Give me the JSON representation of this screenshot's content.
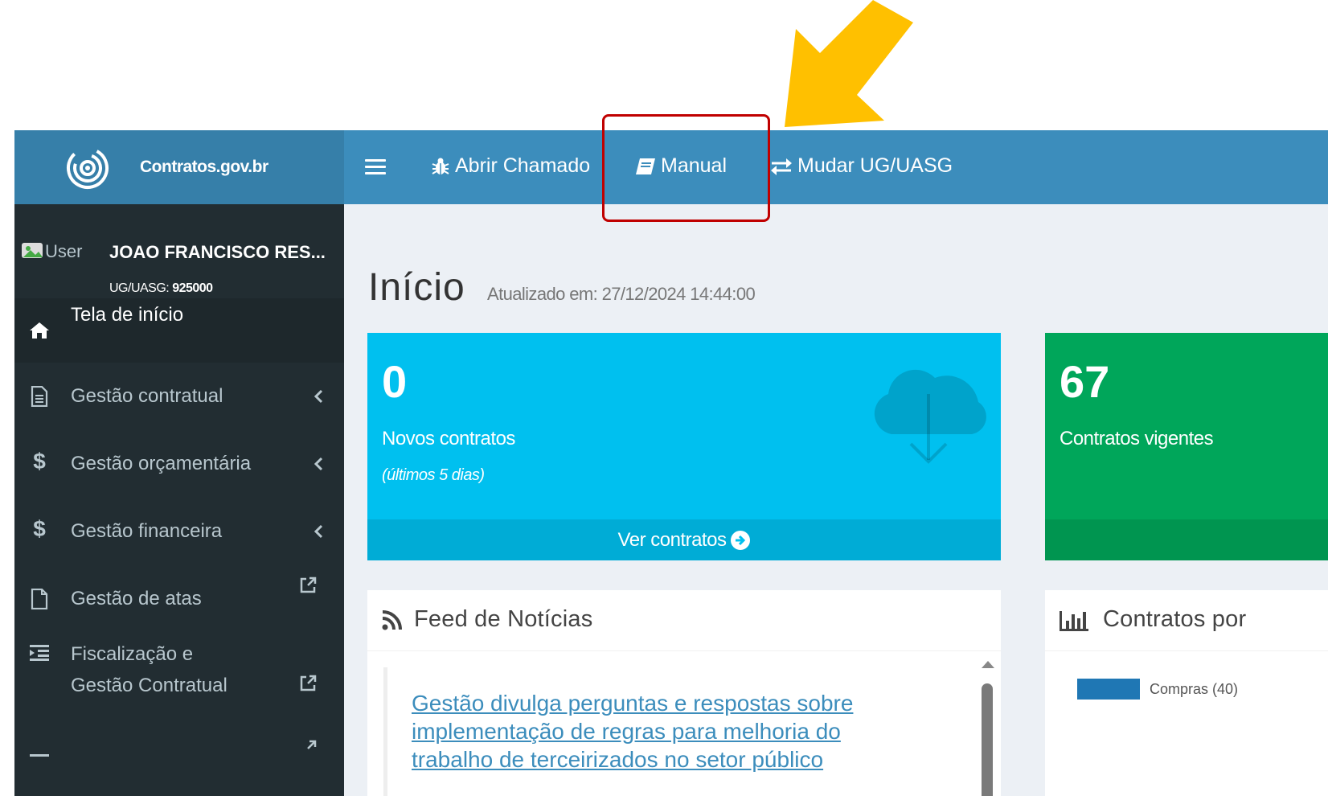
{
  "topbar": {
    "brand_name": "Contratos.gov.br",
    "nav": [
      {
        "label": "Abrir Chamado",
        "icon": "bug-icon"
      },
      {
        "label": "Manual",
        "icon": "book-icon"
      },
      {
        "label": "Mudar UG/UASG",
        "icon": "exchange-icon"
      }
    ]
  },
  "sidebar": {
    "user_alt": "User",
    "user_name": "JOAO FRANCISCO RES...",
    "ug_label": "UG/UASG:",
    "ug_value": "925000",
    "items": [
      {
        "label": "Tela de início",
        "icon": "home-icon",
        "active": true
      },
      {
        "label": "Gestão contratual",
        "icon": "file-text-icon",
        "chevron": true
      },
      {
        "label": "Gestão orçamentária",
        "icon": "dollar-icon",
        "chevron": true
      },
      {
        "label": "Gestão financeira",
        "icon": "dollar-icon",
        "chevron": true
      },
      {
        "label": "Gestão de atas",
        "icon": "file-icon",
        "external": true
      },
      {
        "label_line1": "Fiscalização e",
        "label_line2": "Gestão Contratual",
        "icon": "indent-icon",
        "external": true
      }
    ]
  },
  "main": {
    "title": "Início",
    "updated": "Atualizado em: 27/12/2024 14:44:00",
    "boxes": [
      {
        "number": "0",
        "text": "Novos contratos",
        "subtext": "(últimos 5 dias)",
        "footer": "Ver contratos",
        "color": "#00c0ef",
        "icon": "cloud-download-icon"
      },
      {
        "number": "67",
        "text": "Contratos vigentes",
        "color": "#00a65a"
      }
    ],
    "feed": {
      "title": "Feed de Notícias",
      "icon": "rss-icon",
      "link_text": "Gestão divulga perguntas e respostas sobre implementação de regras para melhoria do trabalho de terceirizados no setor público"
    },
    "chart_panel": {
      "title": "Contratos por",
      "icon": "bar-chart-icon",
      "legend": [
        {
          "label": "Compras (40)",
          "color": "#1f77b4"
        }
      ]
    }
  },
  "annotations": {
    "highlight_color": "#c00000",
    "arrow_color": "#ffc000"
  }
}
